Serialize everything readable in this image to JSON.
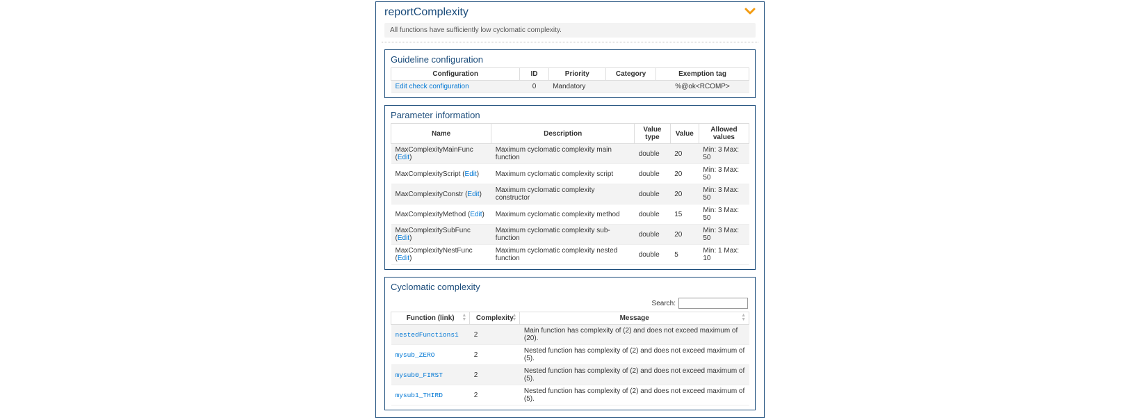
{
  "header": {
    "title": "reportComplexity",
    "summary": "All functions have sufficiently low cyclomatic complexity."
  },
  "guideline": {
    "title": "Guideline configuration",
    "columns": [
      "Configuration",
      "ID",
      "Priority",
      "Category",
      "Exemption tag"
    ],
    "row": {
      "config_link": "Edit check configuration",
      "id": "0",
      "priority": "Mandatory",
      "category": "",
      "exemption": "%@ok<RCOMP>"
    }
  },
  "parameters": {
    "title": "Parameter information",
    "columns": [
      "Name",
      "Description",
      "Value type",
      "Value",
      "Allowed values"
    ],
    "edit_label": "Edit",
    "rows": [
      {
        "name": "MaxComplexityMainFunc",
        "desc": "Maximum cyclomatic complexity main function",
        "vtype": "double",
        "value": "20",
        "allowed": "Min: 3 Max: 50"
      },
      {
        "name": "MaxComplexityScript",
        "desc": "Maximum cyclomatic complexity script",
        "vtype": "double",
        "value": "20",
        "allowed": "Min: 3 Max: 50"
      },
      {
        "name": "MaxComplexityConstr",
        "desc": "Maximum cyclomatic complexity constructor",
        "vtype": "double",
        "value": "20",
        "allowed": "Min: 3 Max: 50"
      },
      {
        "name": "MaxComplexityMethod",
        "desc": "Maximum cyclomatic complexity method",
        "vtype": "double",
        "value": "15",
        "allowed": "Min: 3 Max: 50"
      },
      {
        "name": "MaxComplexitySubFunc",
        "desc": "Maximum cyclomatic complexity sub-function",
        "vtype": "double",
        "value": "20",
        "allowed": "Min: 3 Max: 50"
      },
      {
        "name": "MaxComplexityNestFunc",
        "desc": "Maximum cyclomatic complexity nested function",
        "vtype": "double",
        "value": "5",
        "allowed": "Min: 1 Max: 10"
      }
    ]
  },
  "cyclomatic": {
    "title": "Cyclomatic complexity",
    "search_label": "Search:",
    "search_value": "",
    "columns": [
      "Function (link)",
      "Complexity",
      "Message"
    ],
    "rows": [
      {
        "func": "nestedFunctions1",
        "complexity": "2",
        "msg": "Main function has complexity of (2) and does not exceed maximum of (20)."
      },
      {
        "func": "mysub_ZERO",
        "complexity": "2",
        "msg": "Nested function has complexity of (2) and does not exceed maximum of (5)."
      },
      {
        "func": "mysub0_FIRST",
        "complexity": "2",
        "msg": "Nested function has complexity of (2) and does not exceed maximum of (5)."
      },
      {
        "func": "mysub1_THIRD",
        "complexity": "2",
        "msg": "Nested function has complexity of (2) and does not exceed maximum of (5)."
      }
    ]
  }
}
